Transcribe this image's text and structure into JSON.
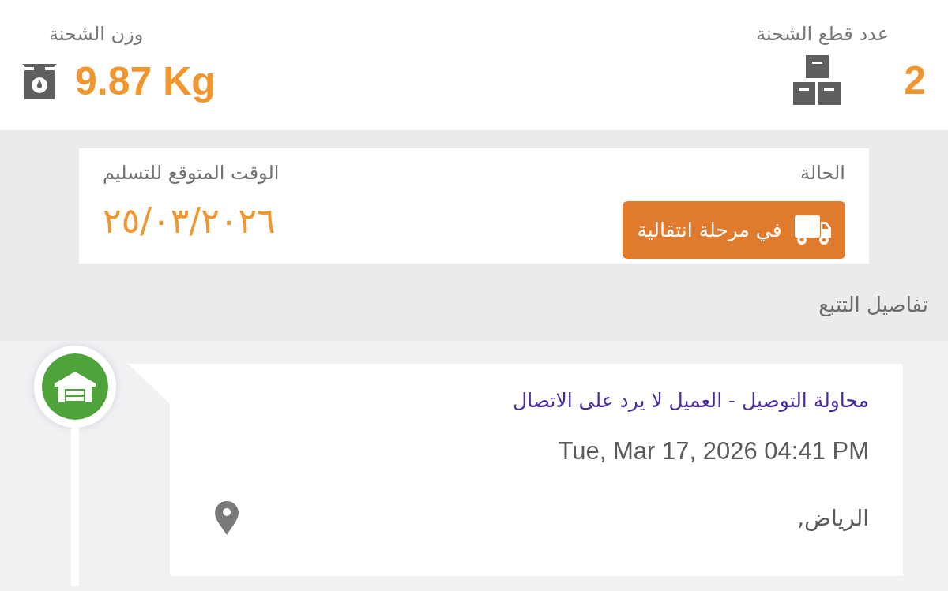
{
  "summary": {
    "weight": {
      "label": "وزن الشحنة",
      "value": "9.87 Kg"
    },
    "pieces": {
      "label": "عدد قطع الشحنة",
      "value": "2"
    }
  },
  "shipment": {
    "status": {
      "label": "الحالة",
      "value": "في مرحلة انتقالية"
    },
    "expected_delivery": {
      "label": "الوقت المتوقع للتسليم",
      "value": "٢٥/٠٣/٢٠٢٦"
    }
  },
  "tracking": {
    "title": "تفاصيل التتبع",
    "events": [
      {
        "title": "محاولة التوصيل - العميل لا يرد على الاتصال",
        "datetime": "Tue, Mar 17, 2026 04:41 PM",
        "location": "الرياض,"
      }
    ]
  }
}
